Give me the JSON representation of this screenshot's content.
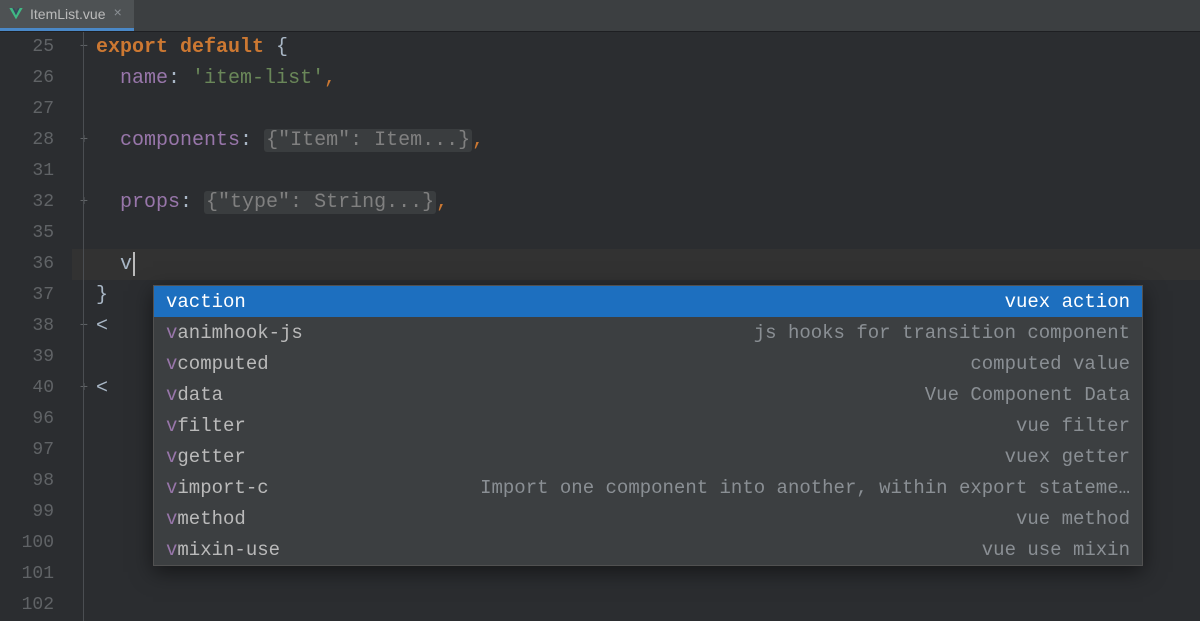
{
  "tab": {
    "filename": "ItemList.vue",
    "icon": "vue-file-icon"
  },
  "gutter": {
    "line_numbers": [
      "25",
      "26",
      "27",
      "28",
      "31",
      "32",
      "35",
      "36",
      "37",
      "38",
      "39",
      "40",
      "96",
      "97",
      "98",
      "99",
      "100",
      "101",
      "102"
    ],
    "fold_markers": {
      "0": "−",
      "3": "+",
      "5": "+",
      "8": "",
      "9": "−",
      "11": "+"
    }
  },
  "code": {
    "l25": {
      "a": "export",
      "b": "default",
      "c": " {"
    },
    "l26": {
      "a": "name",
      "b": ": ",
      "c": "'item-list'",
      "d": ","
    },
    "l28": {
      "a": "components",
      "b": ": ",
      "chip": "{\"Item\": Item...}",
      "d": ","
    },
    "l32": {
      "a": "props",
      "b": ": ",
      "chip": "{\"type\": String...}",
      "d": ","
    },
    "l36": {
      "typed": "v"
    },
    "l37": {
      "a": "}"
    },
    "l38": {
      "a": "<"
    },
    "l40": {
      "a": "<"
    }
  },
  "autocomplete": {
    "query_prefix": "v",
    "selected_index": 0,
    "items": [
      {
        "label": "vaction",
        "desc": "vuex action"
      },
      {
        "label": "vanimhook-js",
        "desc": "js hooks for transition component"
      },
      {
        "label": "vcomputed",
        "desc": "computed value"
      },
      {
        "label": "vdata",
        "desc": "Vue Component Data"
      },
      {
        "label": "vfilter",
        "desc": "vue filter"
      },
      {
        "label": "vgetter",
        "desc": "vuex getter"
      },
      {
        "label": "vimport-c",
        "desc": "Import one component into another, within export stateme…"
      },
      {
        "label": "vmethod",
        "desc": "vue method"
      },
      {
        "label": "vmixin-use",
        "desc": "vue use mixin"
      }
    ]
  },
  "colors": {
    "bg": "#2b2d30",
    "selection": "#1d6fbf",
    "keyword": "#cc7832",
    "property": "#9876aa",
    "string": "#6a8759"
  }
}
